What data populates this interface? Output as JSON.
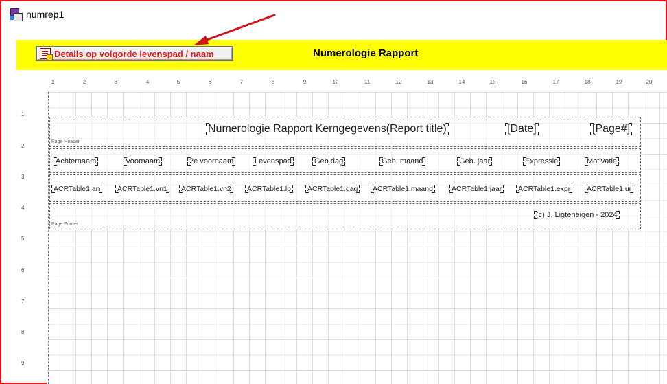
{
  "window": {
    "title": "numrep1",
    "icon": "report-app-icon"
  },
  "toolbar": {
    "button_label": "Details op volgorde levenspad / naam",
    "button_icon": "report-details-icon",
    "title": "Numerologie Rapport",
    "bar_color": "#ffff00",
    "button_text_color": "#e8191b"
  },
  "ruler": {
    "horizontal": [
      "1",
      "2",
      "3",
      "4",
      "5",
      "6",
      "7",
      "8",
      "9",
      "10",
      "11",
      "12",
      "13",
      "14",
      "15",
      "16",
      "17",
      "18",
      "19",
      "20"
    ],
    "vertical": [
      "1",
      "2",
      "3",
      "4",
      "5",
      "6",
      "7",
      "8",
      "9"
    ]
  },
  "report": {
    "page_header": {
      "band_name": "Page Header",
      "title": "Numerologie Rapport Kerngegevens(Report title)",
      "date": "[Date]",
      "page": "[Page#]"
    },
    "column_headers": [
      "Achternaam",
      "Voornaam",
      "2e voornaam",
      "Levenspad",
      "Geb.dag",
      "Geb. maand",
      "Geb. jaar",
      "Expressie",
      "Motivatie"
    ],
    "details": [
      "ACRTable1.an",
      "ACRTable1.vn1",
      "ACRTable1.vn2",
      "ACRTable1.lp",
      "ACRTable1.dag",
      "ACRTable1.maand",
      "ACRTable1.jaar",
      "ACRTable1.expr",
      "ACRTable1.ur"
    ],
    "page_footer": {
      "band_name": "Page Footer",
      "copyright": "(c) J. Ligteneigen - 2024"
    }
  },
  "annotation": {
    "arrow_color": "#d0141a"
  }
}
